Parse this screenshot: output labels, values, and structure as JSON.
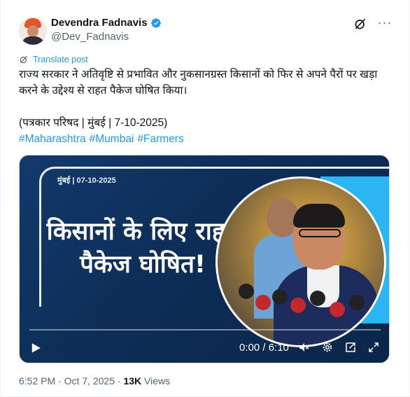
{
  "author": {
    "display_name": "Devendra Fadnavis",
    "handle": "@Dev_Fadnavis",
    "verified": true,
    "verified_color": "#1d9bf0"
  },
  "actions": {
    "grok_icon": "grok-icon",
    "more_icon": "more-icon",
    "more_label": "···"
  },
  "translate_label": "Translate post",
  "post": {
    "line1": "राज्य सरकार ने अतिवृष्टि से प्रभावित और नुकसानग्रस्त किसानों को फिर से अपने पैरों पर खड़ा करने के उद्देश्य से राहत पैकेज घोषित किया।",
    "line2": "(पत्रकार परिषद | मुंबई | 7-10-2025)",
    "hashtags": [
      "#Maharashtra",
      "#Mumbai",
      "#Farmers"
    ]
  },
  "video": {
    "overlay_date": "मुंबई | 07-10-2025",
    "overlay_title": "किसानों के लिए राहत पैकेज घोषित!",
    "time": "0:00 / 6:10",
    "progress": 0,
    "icons": [
      "play-icon",
      "volume-icon",
      "settings-icon",
      "picture-in-picture-icon",
      "fullscreen-icon"
    ]
  },
  "footer": {
    "time": "6:52 PM",
    "separator": "·",
    "date": "Oct 7, 2025",
    "views_count": "13K",
    "views_label": "Views"
  },
  "colors": {
    "link": "#1d9bf0",
    "text": "#0f1419",
    "muted": "#536471",
    "video_bg": "#0d2d57"
  }
}
